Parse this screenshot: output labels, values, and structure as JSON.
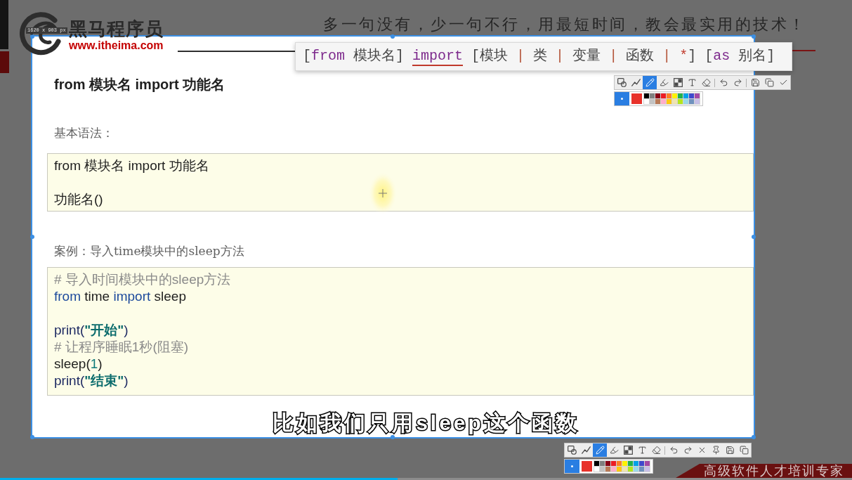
{
  "slide_header": {
    "brand": "黑马程序员",
    "url": "www.itheima.com",
    "tagline": "多一句没有，少一句不行，用最短时间，教会最实用的技术！"
  },
  "capture_frame": {
    "size_label": "1620 x 903 px"
  },
  "syntax_tooltip": {
    "tokens": [
      {
        "text": "[",
        "kind": "plain",
        "underlined": false
      },
      {
        "text": "from",
        "kind": "keyword",
        "underlined": false
      },
      {
        "text": " 模块名] ",
        "kind": "plain",
        "underlined": false
      },
      {
        "text": "import",
        "kind": "keyword",
        "underlined": true
      },
      {
        "text": " [模块 ",
        "kind": "plain",
        "underlined": false
      },
      {
        "text": "|",
        "kind": "separator",
        "underlined": false
      },
      {
        "text": " 类 ",
        "kind": "plain",
        "underlined": false
      },
      {
        "text": "|",
        "kind": "separator",
        "underlined": false
      },
      {
        "text": " 变量 ",
        "kind": "plain",
        "underlined": false
      },
      {
        "text": "|",
        "kind": "separator",
        "underlined": false
      },
      {
        "text": " 函数 ",
        "kind": "plain",
        "underlined": false
      },
      {
        "text": "|",
        "kind": "separator",
        "underlined": false
      },
      {
        "text": " *",
        "kind": "star",
        "underlined": false
      },
      {
        "text": "] [",
        "kind": "plain",
        "underlined": false
      },
      {
        "text": "as",
        "kind": "keyword",
        "underlined": false
      },
      {
        "text": " 别名]",
        "kind": "plain",
        "underlined": false
      }
    ]
  },
  "slide": {
    "title": "from 模块名 import 功能名",
    "sections": [
      {
        "label": "基本语法：",
        "code": {
          "groups": [
            {
              "lines": [
                {
                  "tokens": [
                    {
                      "text": "from 模块名 import 功能名",
                      "kind": "plain"
                    }
                  ]
                }
              ]
            },
            {
              "lines": [
                {
                  "tokens": [
                    {
                      "text": "功能名()",
                      "kind": "plain"
                    }
                  ]
                }
              ]
            }
          ]
        }
      },
      {
        "label": "案例：导入time模块中的sleep方法",
        "code": {
          "groups": [
            {
              "lines": [
                {
                  "tokens": [
                    {
                      "text": "# 导入时间模块中的sleep方法",
                      "kind": "comment"
                    }
                  ]
                },
                {
                  "tokens": [
                    {
                      "text": "from",
                      "kind": "keyword"
                    },
                    {
                      "text": " time ",
                      "kind": "plain"
                    },
                    {
                      "text": "import",
                      "kind": "keyword"
                    },
                    {
                      "text": " sleep",
                      "kind": "plain"
                    }
                  ]
                }
              ]
            },
            {
              "lines": [
                {
                  "tokens": [
                    {
                      "text": "print(",
                      "kind": "builtin"
                    },
                    {
                      "text": "\"开始\"",
                      "kind": "string"
                    },
                    {
                      "text": ")",
                      "kind": "builtin"
                    }
                  ]
                },
                {
                  "tokens": [
                    {
                      "text": "# 让程序睡眠1秒(阻塞)",
                      "kind": "comment"
                    }
                  ]
                },
                {
                  "tokens": [
                    {
                      "text": "sleep(",
                      "kind": "plain"
                    },
                    {
                      "text": "1",
                      "kind": "number"
                    },
                    {
                      "text": ")",
                      "kind": "plain"
                    }
                  ]
                },
                {
                  "tokens": [
                    {
                      "text": "print(",
                      "kind": "builtin"
                    },
                    {
                      "text": "\"结束\"",
                      "kind": "string"
                    },
                    {
                      "text": ")",
                      "kind": "builtin"
                    }
                  ]
                }
              ]
            }
          ]
        }
      }
    ]
  },
  "annotation_toolbars": [
    {
      "tools": [
        {
          "kind": "shape",
          "selected": false
        },
        {
          "kind": "line",
          "selected": false
        },
        {
          "kind": "pencil",
          "selected": true
        },
        {
          "kind": "marker",
          "selected": false
        },
        {
          "kind": "mosaic",
          "selected": false
        },
        {
          "kind": "text",
          "selected": false
        },
        {
          "kind": "eraser",
          "selected": false
        }
      ],
      "actions": [
        {
          "kind": "undo"
        },
        {
          "kind": "redo"
        },
        {
          "kind": "separator"
        },
        {
          "kind": "save"
        },
        {
          "kind": "copy"
        },
        {
          "kind": "confirm"
        }
      ],
      "palette": {
        "current": {
          "color": "#e8322b"
        },
        "swatches": [
          {
            "color": "#000000"
          },
          {
            "color": "#7f7f7f"
          },
          {
            "color": "#880015"
          },
          {
            "color": "#ed1c24"
          },
          {
            "color": "#ff7f27"
          },
          {
            "color": "#fff200"
          },
          {
            "color": "#22b14c"
          },
          {
            "color": "#00a2e8"
          },
          {
            "color": "#3f48cc"
          },
          {
            "color": "#a349a4"
          },
          {
            "color": "#ffffff"
          },
          {
            "color": "#c3c3c3"
          },
          {
            "color": "#b97a57"
          },
          {
            "color": "#ffaec9"
          },
          {
            "color": "#ffc90e"
          },
          {
            "color": "#efe4b0"
          },
          {
            "color": "#b5e61d"
          },
          {
            "color": "#99d9ea"
          },
          {
            "color": "#7092be"
          },
          {
            "color": "#c8bfe7"
          }
        ]
      }
    },
    {
      "tools": [
        {
          "kind": "shape",
          "selected": false
        },
        {
          "kind": "line",
          "selected": false
        },
        {
          "kind": "pencil",
          "selected": true
        },
        {
          "kind": "marker",
          "selected": false
        },
        {
          "kind": "mosaic",
          "selected": false
        },
        {
          "kind": "text",
          "selected": false
        },
        {
          "kind": "eraser",
          "selected": false
        }
      ],
      "actions": [
        {
          "kind": "undo"
        },
        {
          "kind": "redo"
        },
        {
          "kind": "close"
        },
        {
          "kind": "pin"
        },
        {
          "kind": "save"
        },
        {
          "kind": "copy"
        }
      ],
      "palette": {
        "current": {
          "color": "#e8322b"
        },
        "swatches": [
          {
            "color": "#000000"
          },
          {
            "color": "#7f7f7f"
          },
          {
            "color": "#880015"
          },
          {
            "color": "#ed1c24"
          },
          {
            "color": "#ff7f27"
          },
          {
            "color": "#fff200"
          },
          {
            "color": "#22b14c"
          },
          {
            "color": "#00a2e8"
          },
          {
            "color": "#3f48cc"
          },
          {
            "color": "#a349a4"
          },
          {
            "color": "#ffffff"
          },
          {
            "color": "#c3c3c3"
          },
          {
            "color": "#b97a57"
          },
          {
            "color": "#ffaec9"
          },
          {
            "color": "#ffc90e"
          },
          {
            "color": "#efe4b0"
          },
          {
            "color": "#b5e61d"
          },
          {
            "color": "#99d9ea"
          },
          {
            "color": "#7092be"
          },
          {
            "color": "#c8bfe7"
          }
        ]
      }
    }
  ],
  "subtitle": "比如我们只用sleep这个函数",
  "slide_footer": {
    "slogan": "高级软件人才培训专家"
  },
  "video_player": {
    "progress": {
      "level": 0.467
    }
  }
}
